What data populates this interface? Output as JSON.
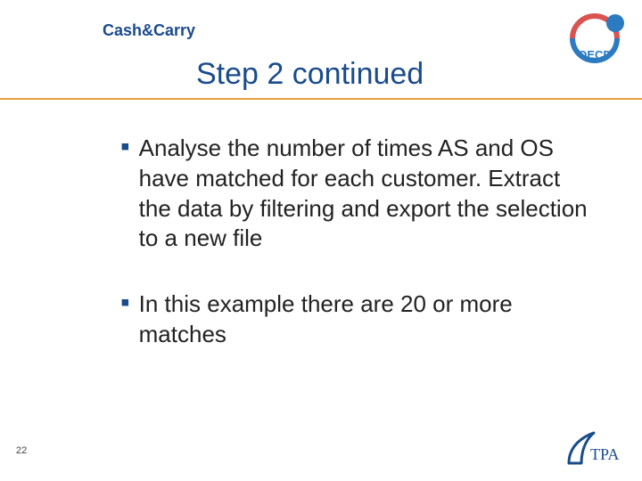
{
  "header": {
    "label": "Cash&Carry"
  },
  "title": "Step 2 continued",
  "bullets": [
    "Analyse the number of times AS and OS have matched for each customer. Extract the data by filtering and export the selection to a new file",
    "In this example there are 20 or more matches"
  ],
  "page_number": "22",
  "logos": {
    "oecd": "oecd-logo",
    "tpa": "tpa-logo"
  },
  "colors": {
    "brand_blue": "#1a4b8c",
    "accent_orange": "#e6a23c"
  }
}
